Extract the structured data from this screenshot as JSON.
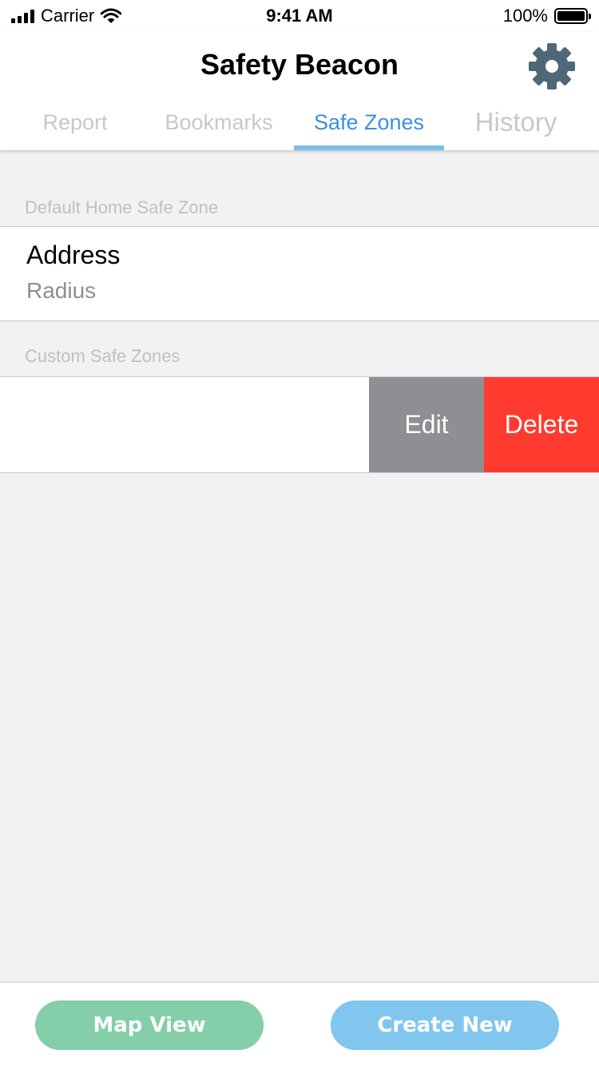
{
  "status_bar": {
    "carrier": "Carrier",
    "time": "9:41 AM",
    "battery": "100%"
  },
  "header": {
    "title": "Safety Beacon",
    "settings_icon": "gear-icon",
    "gear_color": "#4e6878"
  },
  "tabs": [
    {
      "label": "Report",
      "active": false
    },
    {
      "label": "Bookmarks",
      "active": false
    },
    {
      "label": "Safe Zones",
      "active": true
    },
    {
      "label": "History",
      "active": false
    }
  ],
  "sections": {
    "default": {
      "header": "Default Home Safe Zone",
      "title": "Address",
      "subtitle": "Radius"
    },
    "custom": {
      "header": "Custom Safe Zones",
      "actions": {
        "edit": "Edit",
        "delete": "Delete"
      }
    }
  },
  "bottom_bar": {
    "map_view": "Map View",
    "create_new": "Create New"
  },
  "colors": {
    "accent": "#3c8fe0",
    "tab_underline": "#7cc0ea",
    "delete": "#ff3b30",
    "edit": "#8e8e93",
    "map_button": "#84ceaa",
    "create_button": "#80c6ee"
  }
}
